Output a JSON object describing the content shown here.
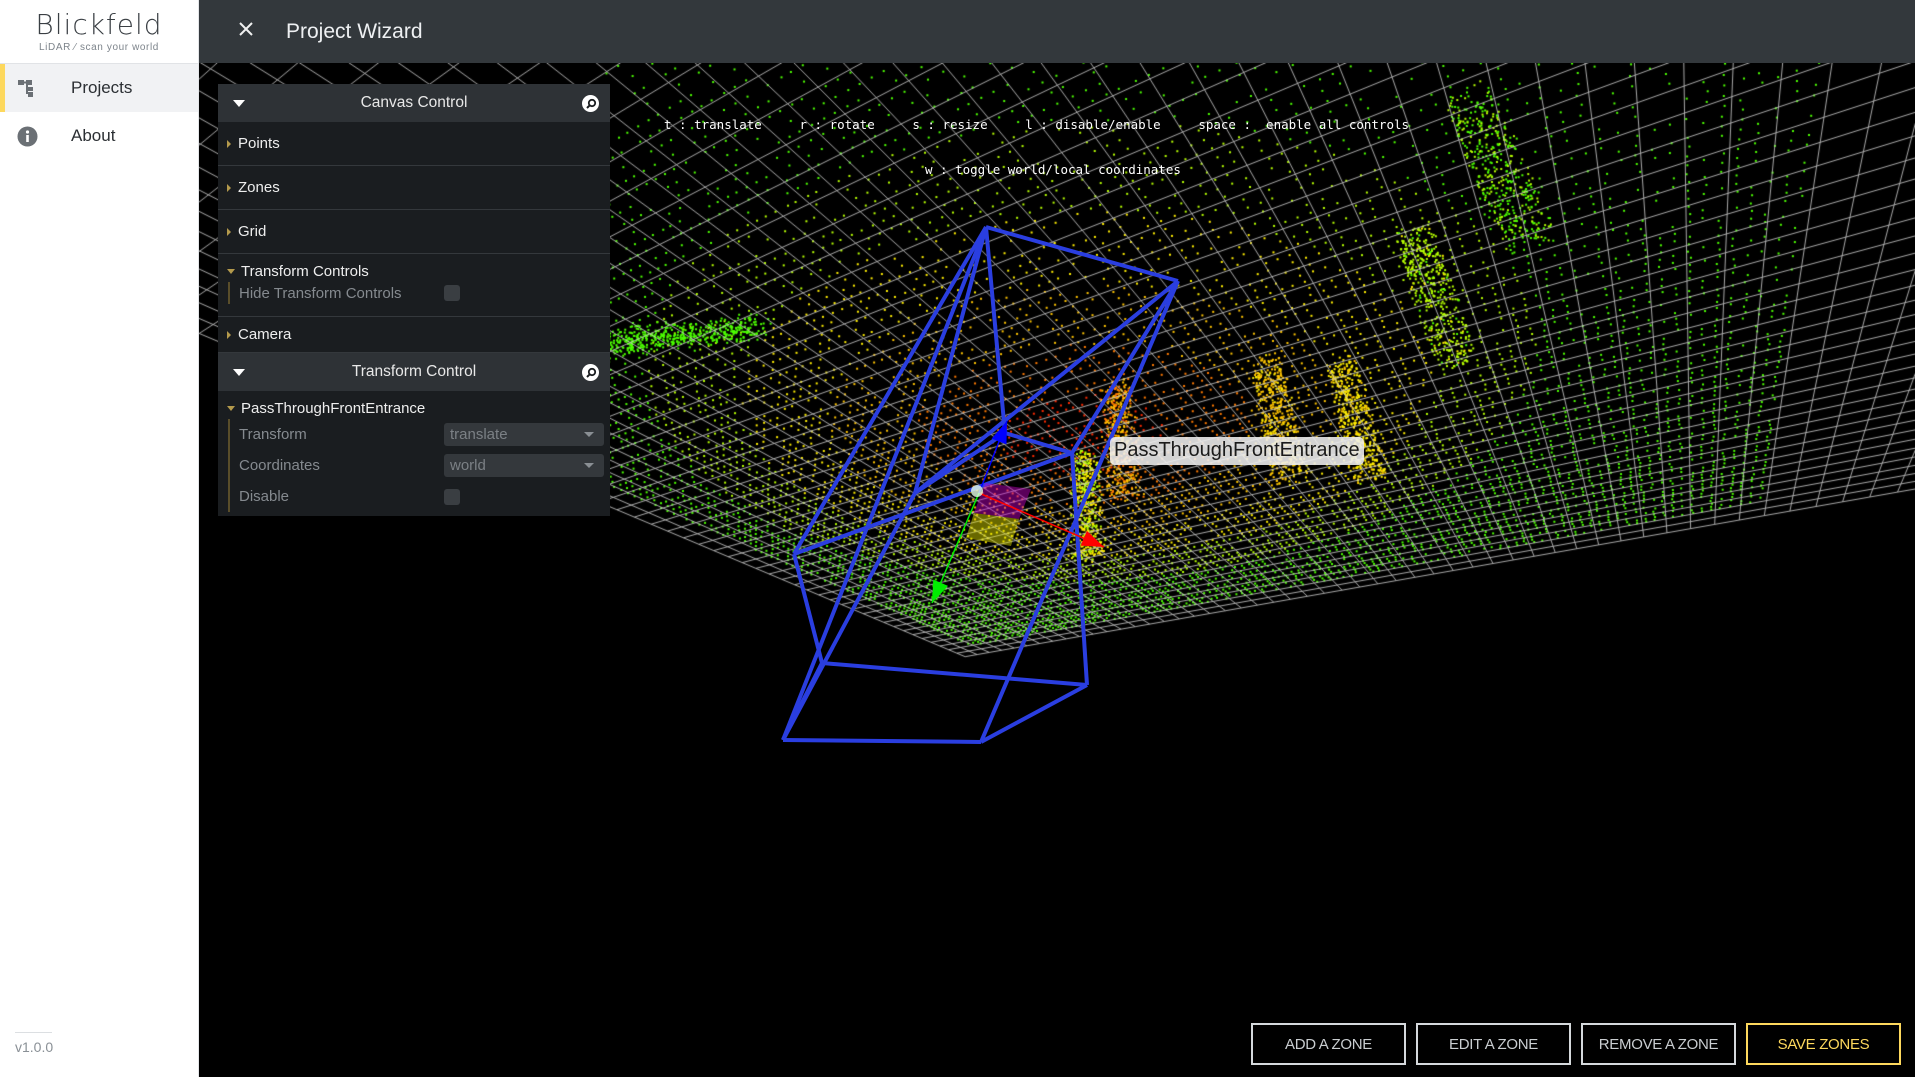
{
  "brand": {
    "name": "Blickfeld",
    "tagline": "LiDAR ⁄ scan your world"
  },
  "sidebar": {
    "items": [
      {
        "label": "Projects",
        "icon": "project-tree-icon",
        "active": true
      },
      {
        "label": "About",
        "icon": "info-icon",
        "active": false
      }
    ],
    "version": "v1.0.0"
  },
  "header": {
    "title": "Project Wizard",
    "close_icon": "close-icon"
  },
  "hotkeys": {
    "line1": "t : translate     r : rotate     s : resize     l : disable/enable     space :  enable all controls",
    "line2": "w : toggle world/local coordinates"
  },
  "canvas_control": {
    "title": "Canvas Control",
    "folders": [
      "Points",
      "Zones",
      "Grid"
    ],
    "transform_controls": {
      "label": "Transform Controls",
      "hide_label": "Hide Transform Controls",
      "hide_checked": false
    },
    "camera_label": "Camera"
  },
  "transform_control": {
    "title": "Transform Control",
    "zone_name": "PassThroughFrontEntrance",
    "transform_label": "Transform",
    "transform_value": "translate",
    "coordinates_label": "Coordinates",
    "coordinates_value": "world",
    "disable_label": "Disable",
    "disable_checked": false
  },
  "scene": {
    "zone_label": "PassThroughFrontEntrance",
    "zone_color": "#2a3ee0",
    "gizmo_colors": {
      "x": "#ff0000",
      "y": "#00ee00",
      "z": "#0000ff"
    },
    "grid_color": "#c8c8c8",
    "point_palette": [
      "#ff2a00",
      "#ff7a00",
      "#ffc400",
      "#ffee00",
      "#b6ff00",
      "#4cff00"
    ]
  },
  "actions": {
    "add": "ADD A ZONE",
    "edit": "EDIT A ZONE",
    "remove": "REMOVE A ZONE",
    "save": "SAVE ZONES"
  }
}
